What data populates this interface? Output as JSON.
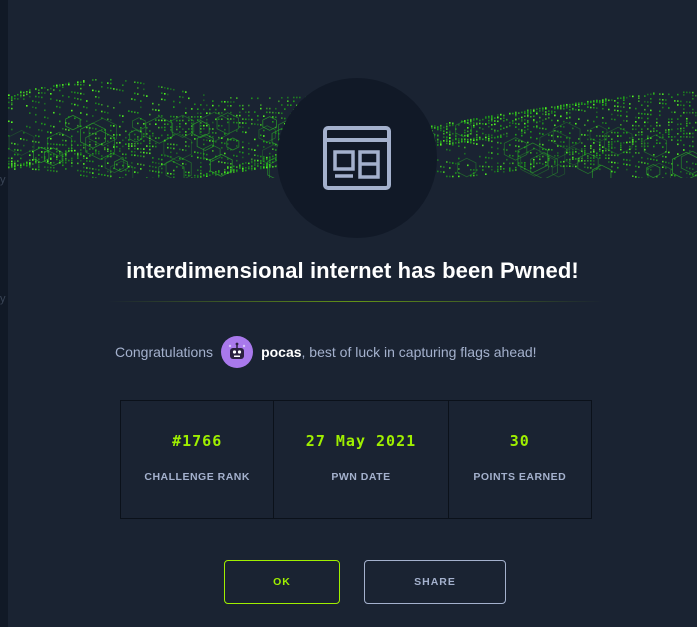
{
  "modal": {
    "title": "interdimensional internet has been Pwned!",
    "congrats_prefix": "Congratulations",
    "username": "pocas",
    "congrats_suffix": ", best of luck in capturing flags ahead!",
    "icon": "browser-window-icon",
    "avatar_icon": "robot-avatar"
  },
  "stats": [
    {
      "value": "#1766",
      "label": "CHALLENGE RANK"
    },
    {
      "value": "27 May 2021",
      "label": "PWN DATE"
    },
    {
      "value": "30",
      "label": "POINTS EARNED"
    }
  ],
  "buttons": {
    "ok": "OK",
    "share": "SHARE"
  },
  "colors": {
    "accent": "#9fef00",
    "background": "#1a2332",
    "text_muted": "#a4b1cd",
    "avatar": "#a979ec"
  }
}
